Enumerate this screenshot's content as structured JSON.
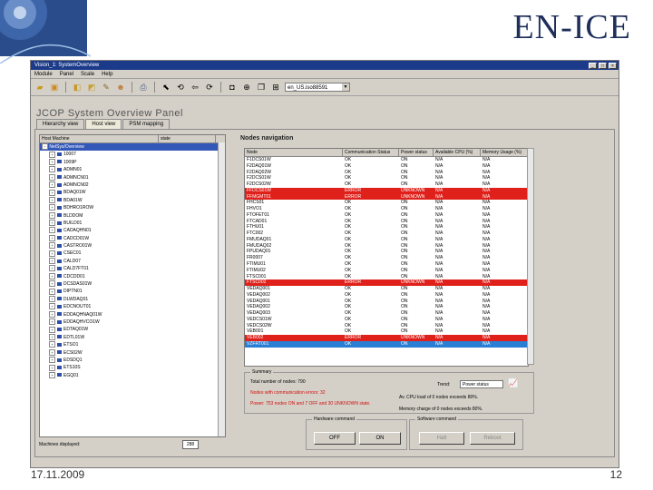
{
  "slide": {
    "title": "EN-ICE",
    "date": "17.11.2009",
    "page": "12"
  },
  "window": {
    "title": "Vision_1: SystemOverview",
    "menu": [
      "Module",
      "Panel",
      "Scale",
      "Help"
    ],
    "toolbar_select": "en_US.iso88591",
    "panel_title": "JCOP System Overview Panel",
    "tabs": [
      "Hierarchy view",
      "Host view",
      "PSM mapping"
    ],
    "tree_headers": [
      "Host Machine",
      "state"
    ],
    "tree_root": "NetSys/Overview",
    "tree_items": [
      "10007",
      "1009P",
      "ADMN01",
      "ADMNCN01",
      "ADMNCN02",
      "BDAQ01W",
      "BDA01W",
      "BDHRO1ROW",
      "BLDDOM",
      "BUILD01",
      "CADAQHN01",
      "CADCD01W",
      "CASTRO01W",
      "CSEC01",
      "CALD07",
      "CALD7FT01",
      "CDCDD01",
      "DCSDAS01W",
      "DIPTN01",
      "DLWDAQ01",
      "EDCNOUT01",
      "EDDAQHNAQ01W",
      "EDDAQHVCO1W",
      "EDTAQ01W",
      "EDTL01W",
      "ETSO1",
      "ECS02W",
      "EDSDQ1",
      "ETS10S",
      "EGQ01"
    ],
    "machines_label": "Machines displayed:",
    "machines_value": "288",
    "nodes_title": "Nodes navigation",
    "node_headers": [
      "Node",
      "Communication Status",
      "Power status",
      "Available CPU (%)",
      "Memory Usage (%)"
    ],
    "node_rows": [
      [
        "F1DCS01W",
        "OK",
        "ON",
        "N/A",
        "N/A",
        "ok"
      ],
      [
        "F2DAQ01W",
        "OK",
        "ON",
        "N/A",
        "N/A",
        "ok"
      ],
      [
        "F2DAQ02W",
        "OK",
        "ON",
        "N/A",
        "N/A",
        "ok"
      ],
      [
        "F2DCS01W",
        "OK",
        "ON",
        "N/A",
        "N/A",
        "ok"
      ],
      [
        "F2DCS02W",
        "OK",
        "ON",
        "N/A",
        "N/A",
        "ok"
      ],
      [
        "FFDCS01W",
        "ERROR",
        "UNKNOWN",
        "N/A",
        "N/A",
        "err"
      ],
      [
        "FFMGMT01",
        "ERROR",
        "UNKNOWN",
        "N/A",
        "N/A",
        "err"
      ],
      [
        "FHCS01",
        "OK",
        "ON",
        "N/A",
        "N/A",
        "ok"
      ],
      [
        "FHVO1",
        "OK",
        "ON",
        "N/A",
        "N/A",
        "ok"
      ],
      [
        "FTOFET01",
        "OK",
        "ON",
        "N/A",
        "N/A",
        "ok"
      ],
      [
        "FTCAD01",
        "OK",
        "ON",
        "N/A",
        "N/A",
        "ok"
      ],
      [
        "FTHU01",
        "OK",
        "ON",
        "N/A",
        "N/A",
        "ok"
      ],
      [
        "FTC002",
        "OK",
        "ON",
        "N/A",
        "N/A",
        "ok"
      ],
      [
        "FMUDAQ01",
        "OK",
        "ON",
        "N/A",
        "N/A",
        "ok"
      ],
      [
        "FMUDAQ02",
        "OK",
        "ON",
        "N/A",
        "N/A",
        "ok"
      ],
      [
        "FPUDAQ01",
        "OK",
        "ON",
        "N/A",
        "N/A",
        "ok"
      ],
      [
        "FR0007",
        "OK",
        "ON",
        "N/A",
        "N/A",
        "ok"
      ],
      [
        "FTIMU01",
        "OK",
        "ON",
        "N/A",
        "N/A",
        "ok"
      ],
      [
        "FTIMU02",
        "OK",
        "ON",
        "N/A",
        "N/A",
        "ok"
      ],
      [
        "FTSC001",
        "OK",
        "ON",
        "N/A",
        "N/A",
        "ok"
      ],
      [
        "FTSC002",
        "ERROR",
        "UNKNOWN",
        "N/A",
        "N/A",
        "err"
      ],
      [
        "VEDAQ001",
        "OK",
        "ON",
        "N/A",
        "N/A",
        "ok"
      ],
      [
        "VEDAQ002",
        "OK",
        "ON",
        "N/A",
        "N/A",
        "ok"
      ],
      [
        "VEDAQ001",
        "OK",
        "ON",
        "N/A",
        "N/A",
        "ok"
      ],
      [
        "VEDAQ002",
        "OK",
        "ON",
        "N/A",
        "N/A",
        "ok"
      ],
      [
        "VEDAQ003",
        "OK",
        "ON",
        "N/A",
        "N/A",
        "ok"
      ],
      [
        "VEDCS01W",
        "OK",
        "ON",
        "N/A",
        "N/A",
        "ok"
      ],
      [
        "VEDCS02W",
        "OK",
        "ON",
        "N/A",
        "N/A",
        "ok"
      ],
      [
        "VEB001",
        "OK",
        "ON",
        "N/A",
        "N/A",
        "ok"
      ],
      [
        "VEB002",
        "ERROR",
        "UNKNOWN",
        "N/A",
        "N/A",
        "err"
      ],
      [
        "VZFRT001",
        "OK",
        "ON",
        "N/A",
        "N/A",
        "sel"
      ]
    ],
    "summary": {
      "label": "Summary",
      "total": "Total number of nodes: 790",
      "comm_errors": "Nodes with communication errors: 32",
      "power": "Power: 753 nodes ON and 7 OFF and 30 UNKNOWN state.",
      "cpu": "Av. CPU load of 0 nodes exceeds 80%.",
      "memory": "Memory charge of 0 nodes exceeds 80%.",
      "trend_label": "Trend:",
      "trend_value": "Power status"
    },
    "hardware": {
      "label": "Hardware command",
      "off": "OFF",
      "on": "ON"
    },
    "software": {
      "label": "Software command",
      "halt": "Halt",
      "reboot": "Reboot"
    }
  }
}
